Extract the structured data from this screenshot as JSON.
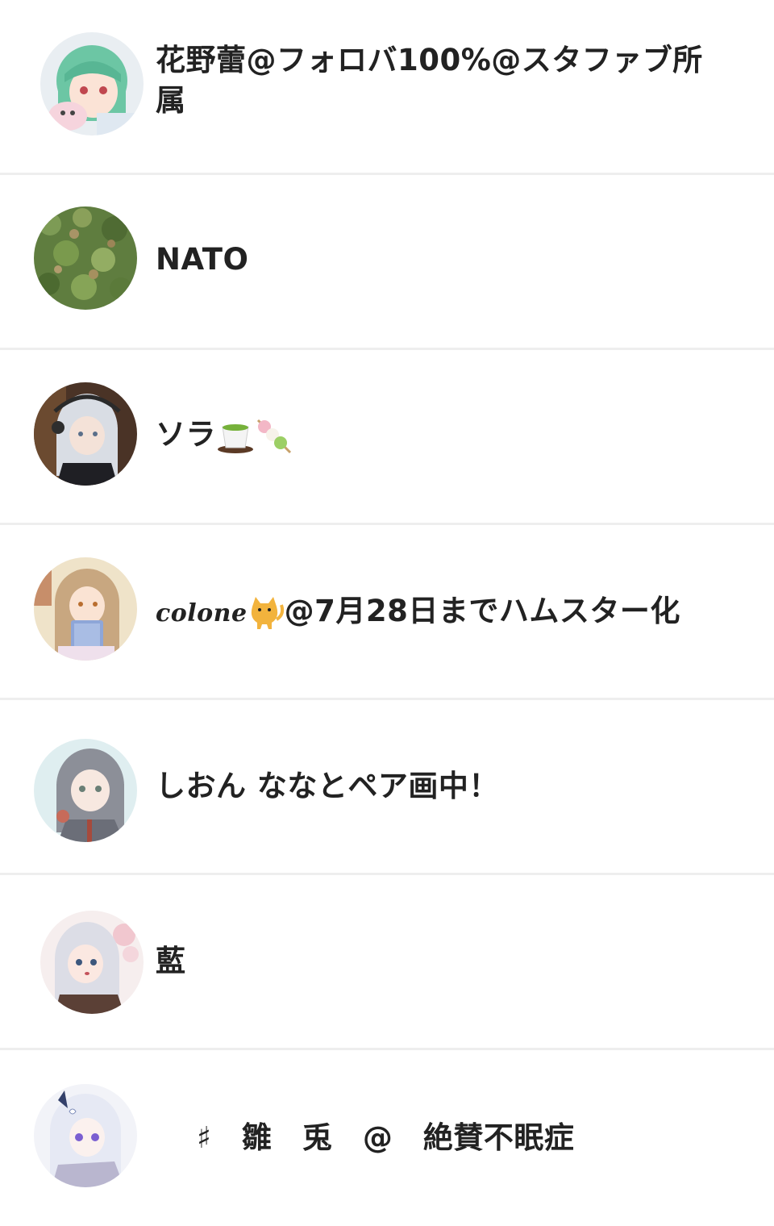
{
  "users": [
    {
      "name": "花野蕾@フォロバ100%@スタファブ所属",
      "avatar": "green-hair-anime-avatar"
    },
    {
      "name": "NATO",
      "avatar": "green-foliage-avatar"
    },
    {
      "name": "ソラ",
      "emoji": [
        "green-tea-icon",
        "dango-icon"
      ],
      "avatar": "silver-hair-headphones-avatar"
    },
    {
      "name_script": "colone",
      "emoji": [
        "cat-icon"
      ],
      "name": "@7月28日までハムスター化",
      "avatar": "brown-hair-book-avatar"
    },
    {
      "name": "しおん ななとペア画中！",
      "avatar": "gray-hair-anime-avatar"
    },
    {
      "name": "藍",
      "avatar": "white-hair-anime-avatar"
    },
    {
      "name": "♯　雛　兎　@　絶賛不眠症",
      "avatar": "white-hair-purple-eyes-avatar"
    }
  ],
  "colors": {
    "text": "#222222",
    "divider": "#eeeeee",
    "background": "#ffffff"
  }
}
